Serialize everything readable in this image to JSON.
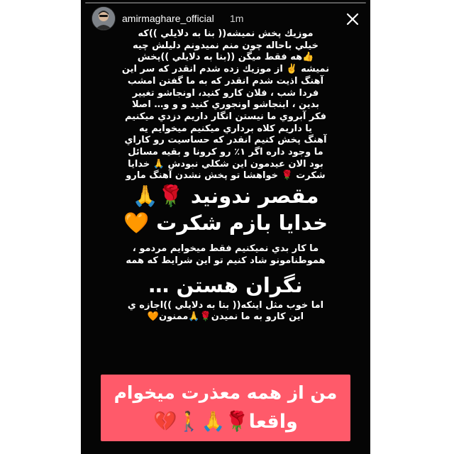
{
  "header": {
    "username": "amirmaghare_official",
    "timestamp": "1m",
    "avatar_icon": "profile-avatar",
    "close_icon": "close-icon"
  },
  "story": {
    "progress": 0.0,
    "lines_top": [
      "موزيك پخش نميشه(( بنا به دلايلي ))كه",
      "خيلي باحاله چون منم نميدونم دليلش چيه",
      "👍هه فقط ميگن ((بنا به دلايلي ))پخش",
      "نميشه ✌️ از موزيك زده شدم انقدر كه سر اين",
      "آهنگ اذيت شدم انقدر كه به ما گفتن امشب",
      "فردا شب ، فلان كارو كنيد، اونجاشو تغيير",
      "بدين ، اينجاشو اونجوري كنيد و و و… اصلا",
      "فكر آبروي ما نيستن انگار داريم دزدي ميكنيم",
      "يا داريم كلاه برداري ميكنيم  ميخوايم يه",
      "آهنگ پخش كنيم انقدر كه حساسيت رو كاراي",
      "ما وجود داره اگر ١٪ رو كرونا و بقيه مسائل",
      "بود الان عيدمون اين شكلي نبودش 🙏 خدايا",
      "شكرت 🌹 خواهشا تو پخش نشدن آهنگ مارو"
    ],
    "big_line_1": "مقصر ندونيد 🌹🙏",
    "big_line_2": "خدايا بازم شكرت 🧡",
    "lines_middle": [
      "ما كار بدي نميكنيم فقط ميخوايم مردمو ،",
      "هموطنامونو شاد كنيم تو اين شرايط كه همه"
    ],
    "big_line_3": "نگران هستن …",
    "lines_bottom": [
      "اما خوب مثل اينكه(( بنا به دلايلي ))اجازه ي",
      "اين كارو به ما نميدن🌹🙏ممنون🧡"
    ],
    "banner": {
      "background": "#ff5a6a",
      "line1": "من از همه معذرت ميخوام",
      "line2": "واقعا🌹🙏🚶💔"
    }
  }
}
